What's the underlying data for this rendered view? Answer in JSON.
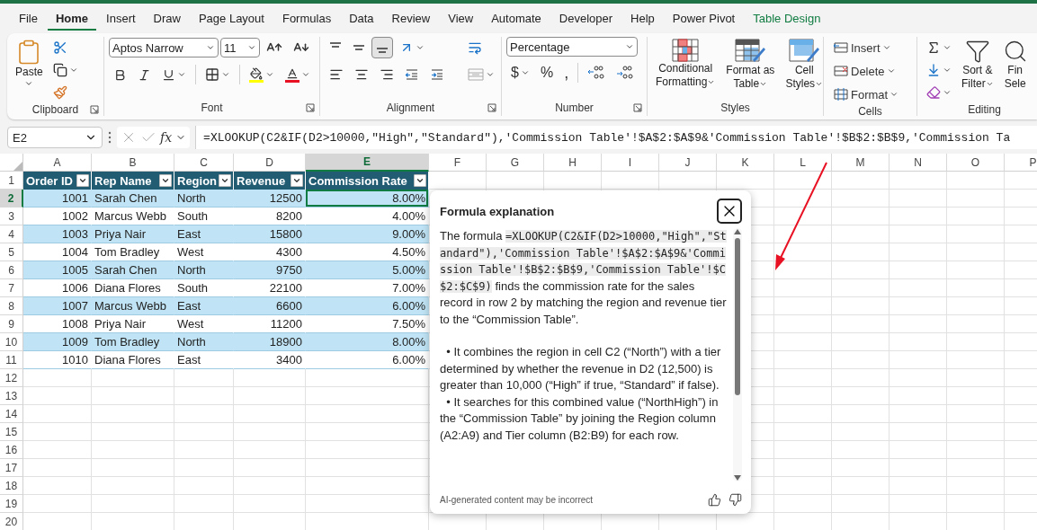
{
  "menu_tabs": [
    {
      "label": "File",
      "selected": false,
      "kind": "standard"
    },
    {
      "label": "Home",
      "selected": true,
      "kind": "standard"
    },
    {
      "label": "Insert",
      "selected": false,
      "kind": "standard"
    },
    {
      "label": "Draw",
      "selected": false,
      "kind": "standard"
    },
    {
      "label": "Page Layout",
      "selected": false,
      "kind": "standard"
    },
    {
      "label": "Formulas",
      "selected": false,
      "kind": "standard"
    },
    {
      "label": "Data",
      "selected": false,
      "kind": "standard"
    },
    {
      "label": "Review",
      "selected": false,
      "kind": "standard"
    },
    {
      "label": "View",
      "selected": false,
      "kind": "standard"
    },
    {
      "label": "Automate",
      "selected": false,
      "kind": "standard"
    },
    {
      "label": "Developer",
      "selected": false,
      "kind": "standard"
    },
    {
      "label": "Help",
      "selected": false,
      "kind": "standard"
    },
    {
      "label": "Power Pivot",
      "selected": false,
      "kind": "standard"
    },
    {
      "label": "Table Design",
      "selected": false,
      "kind": "contextual"
    }
  ],
  "ribbon": {
    "clipboard": {
      "paste": "Paste",
      "label": "Clipboard"
    },
    "font": {
      "font_name": "Aptos Narrow",
      "font_size": "11",
      "label": "Font"
    },
    "alignment": {
      "vertical": [
        {
          "selected": false
        },
        {
          "selected": false
        },
        {
          "selected": true
        }
      ],
      "label": "Alignment"
    },
    "number": {
      "format": "Percentage",
      "currency": "$",
      "percent": "%",
      "comma": ",",
      "label": "Number"
    },
    "styles": {
      "buttons": [
        {
          "kind": "conditional",
          "lines": [
            "Conditional",
            "Formatting"
          ]
        },
        {
          "kind": "format_table",
          "lines": [
            "Format as",
            "Table"
          ]
        },
        {
          "kind": "cell_styles",
          "lines": [
            "Cell",
            "Styles"
          ]
        }
      ],
      "label": "Styles"
    },
    "cells": {
      "buttons": [
        {
          "kind": "insert",
          "label": "Insert"
        },
        {
          "kind": "delete",
          "label": "Delete"
        },
        {
          "kind": "format",
          "label": "Format"
        }
      ],
      "label": "Cells"
    },
    "editing": {
      "buttons": [
        {
          "kind": "sort",
          "lines": [
            "Sort &",
            "Filter"
          ]
        },
        {
          "kind": "find",
          "lines": [
            "Fin",
            "Sele"
          ]
        }
      ],
      "label": "Editing"
    }
  },
  "formula_bar": {
    "name_box": "E2",
    "function_label": "fx",
    "formula": "=XLOOKUP(C2&IF(D2>10000,\"High\",\"Standard\"),'Commission Table'!$A$2:$A$9&'Commission Table'!$B$2:$B$9,'Commission Ta"
  },
  "grid": {
    "columns": [
      {
        "label": "A",
        "selected": false
      },
      {
        "label": "B",
        "selected": false
      },
      {
        "label": "C",
        "selected": false
      },
      {
        "label": "D",
        "selected": false
      },
      {
        "label": "E",
        "selected": true
      },
      {
        "label": "F",
        "selected": false
      },
      {
        "label": "G",
        "selected": false
      },
      {
        "label": "H",
        "selected": false
      },
      {
        "label": "I",
        "selected": false
      },
      {
        "label": "J",
        "selected": false
      },
      {
        "label": "K",
        "selected": false
      },
      {
        "label": "L",
        "selected": false
      },
      {
        "label": "M",
        "selected": false
      },
      {
        "label": "N",
        "selected": false
      },
      {
        "label": "O",
        "selected": false
      },
      {
        "label": "P",
        "selected": false
      }
    ],
    "rows": [
      {
        "label": "1",
        "selected": false
      },
      {
        "label": "2",
        "selected": true
      },
      {
        "label": "3",
        "selected": false
      },
      {
        "label": "4",
        "selected": false
      },
      {
        "label": "5",
        "selected": false
      },
      {
        "label": "6",
        "selected": false
      },
      {
        "label": "7",
        "selected": false
      },
      {
        "label": "8",
        "selected": false
      },
      {
        "label": "9",
        "selected": false
      },
      {
        "label": "10",
        "selected": false
      },
      {
        "label": "11",
        "selected": false
      },
      {
        "label": "12",
        "selected": false
      },
      {
        "label": "13",
        "selected": false
      },
      {
        "label": "14",
        "selected": false
      },
      {
        "label": "15",
        "selected": false
      },
      {
        "label": "16",
        "selected": false
      },
      {
        "label": "17",
        "selected": false
      },
      {
        "label": "18",
        "selected": false
      },
      {
        "label": "19",
        "selected": false
      },
      {
        "label": "20",
        "selected": false
      }
    ]
  },
  "table": {
    "columns": [
      {
        "label": "Order ID",
        "kind": "number"
      },
      {
        "label": "Rep Name",
        "kind": "text"
      },
      {
        "label": "Region",
        "kind": "text"
      },
      {
        "label": "Revenue",
        "kind": "number"
      },
      {
        "label": "Commission Rate",
        "kind": "number"
      }
    ],
    "rows": [
      {
        "selected": true,
        "cells": [
          "1001",
          "Sarah Chen",
          "North",
          "12500",
          "8.00%"
        ]
      },
      {
        "selected": false,
        "cells": [
          "1002",
          "Marcus Webb",
          "South",
          "8200",
          "4.00%"
        ]
      },
      {
        "selected": false,
        "cells": [
          "1003",
          "Priya Nair",
          "East",
          "15800",
          "9.00%"
        ]
      },
      {
        "selected": false,
        "cells": [
          "1004",
          "Tom Bradley",
          "West",
          "4300",
          "4.50%"
        ]
      },
      {
        "selected": false,
        "cells": [
          "1005",
          "Sarah Chen",
          "North",
          "9750",
          "5.00%"
        ]
      },
      {
        "selected": false,
        "cells": [
          "1006",
          "Diana Flores",
          "South",
          "22100",
          "7.00%"
        ]
      },
      {
        "selected": false,
        "cells": [
          "1007",
          "Marcus Webb",
          "East",
          "6600",
          "6.00%"
        ]
      },
      {
        "selected": false,
        "cells": [
          "1008",
          "Priya Nair",
          "West",
          "11200",
          "7.50%"
        ]
      },
      {
        "selected": false,
        "cells": [
          "1009",
          "Tom Bradley",
          "North",
          "18900",
          "8.00%"
        ]
      },
      {
        "selected": false,
        "cells": [
          "1010",
          "Diana Flores",
          "East",
          "3400",
          "6.00%"
        ]
      }
    ]
  },
  "explanation": {
    "title": "Formula explanation",
    "paragraphs": [
      {
        "kind": "formula",
        "before": "The formula",
        "code": "=XLOOKUP(C2&IF(D2>10000,\"High\",\"Standard\"),'Commission Table'!$A$2:$A$9&'Commission Table'!$B$2:$B$9,'Commission Table'!$C$2:$C$9)",
        "after": "finds the commission rate for the sales record in row 2 by matching the region and revenue tier to the “Commission Table”."
      },
      {
        "kind": "bullet",
        "text": "• It combines the region in cell C2 (“North”) with a tier determined by whether the revenue in D2 (12,500) is greater than 10,000 (“High” if true, “Standard” if false)."
      },
      {
        "kind": "bullet",
        "text": "• It searches for this combined value (“NorthHigh”) in the “Commission Table” by joining the Region column (A2:A9) and Tier column (B2:B9) for each row."
      }
    ],
    "footer": "AI-generated content may be incorrect"
  }
}
